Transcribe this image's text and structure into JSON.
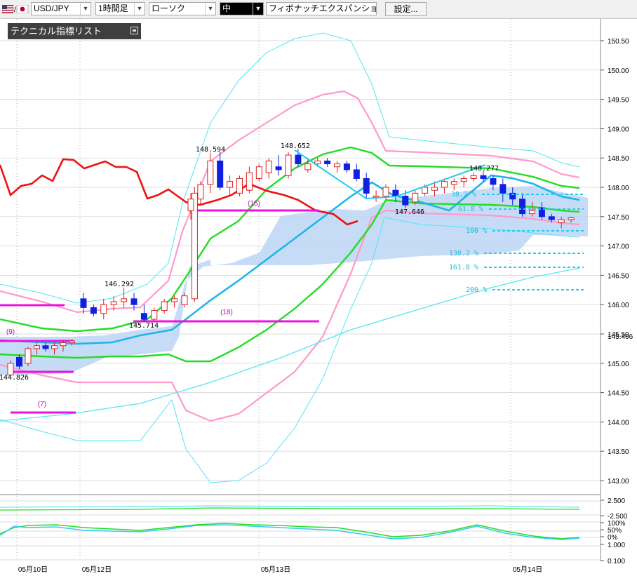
{
  "toolbar": {
    "pair": "USD/JPY",
    "timeframe": "1時間足",
    "chart_type": "ローソク",
    "size": "中",
    "tool": "フィボナッチエクスパンション",
    "settings_button": "設定..."
  },
  "indicator_list": {
    "label": "テクニカル指標リスト"
  },
  "chart_data": {
    "type": "candlestick",
    "price_axis": {
      "min": 142.85,
      "max": 150.55,
      "ticks": [
        "150.50",
        "150.00",
        "149.50",
        "149.00",
        "148.50",
        "148.00",
        "147.50",
        "147.00",
        "146.50",
        "146.00",
        "145.50",
        "145.00",
        "144.50",
        "144.00",
        "143.50",
        "143.00"
      ],
      "edge_label": "145.466"
    },
    "sub_axis": {
      "ticks": [
        "2.500",
        "-2.500",
        "100%",
        "50%",
        "0%",
        "1.000",
        "0.100"
      ]
    },
    "date_labels": [
      "05月10日",
      "05月12日",
      "05月13日",
      "05月14日"
    ],
    "price_labels": [
      "144.826",
      "146.292",
      "145.714",
      "148.594",
      "148.652",
      "147.646",
      "148.277"
    ],
    "line_labels": [
      "(9)",
      "(7)",
      "(18)",
      "(15)"
    ],
    "fib_levels": [
      "38.2 %",
      "61.8 %",
      "100 %",
      "138.2 %",
      "161.8 %",
      "200 %"
    ],
    "candles": [
      [
        144.8,
        145.05,
        144.83,
        145.0
      ],
      [
        145.1,
        145.15,
        144.9,
        144.95
      ],
      [
        145.0,
        145.28,
        144.95,
        145.25
      ],
      [
        145.25,
        145.35,
        145.15,
        145.3
      ],
      [
        145.3,
        145.35,
        145.2,
        145.25
      ],
      [
        145.25,
        145.35,
        145.15,
        145.3
      ],
      [
        145.3,
        145.4,
        145.2,
        145.35
      ],
      [
        145.35,
        145.4,
        145.3,
        145.38
      ],
      [
        146.1,
        146.2,
        145.85,
        145.95
      ],
      [
        145.95,
        146.0,
        145.8,
        145.85
      ],
      [
        145.85,
        146.1,
        145.75,
        146.0
      ],
      [
        146.0,
        146.15,
        145.9,
        146.05
      ],
      [
        146.05,
        146.29,
        145.95,
        146.1
      ],
      [
        146.1,
        146.2,
        145.9,
        146.0
      ],
      [
        145.85,
        146.0,
        145.71,
        145.75
      ],
      [
        145.75,
        145.95,
        145.72,
        145.9
      ],
      [
        145.9,
        146.1,
        145.85,
        146.05
      ],
      [
        146.05,
        146.15,
        145.95,
        146.1
      ],
      [
        146.0,
        146.2,
        145.95,
        146.15
      ],
      [
        146.1,
        148.0,
        146.05,
        147.9
      ],
      [
        147.6,
        147.9,
        147.45,
        147.8
      ],
      [
        147.8,
        148.1,
        147.7,
        148.05
      ],
      [
        148.05,
        148.59,
        147.9,
        148.45
      ],
      [
        148.45,
        148.6,
        147.95,
        148.0
      ],
      [
        148.0,
        148.2,
        147.85,
        148.1
      ],
      [
        147.9,
        148.2,
        147.85,
        148.15
      ],
      [
        147.95,
        148.35,
        147.9,
        148.25
      ],
      [
        148.15,
        148.4,
        148.1,
        148.35
      ],
      [
        148.25,
        148.5,
        148.15,
        148.45
      ],
      [
        148.35,
        148.55,
        148.2,
        148.3
      ],
      [
        148.2,
        148.6,
        148.15,
        148.55
      ],
      [
        148.55,
        148.65,
        148.35,
        148.4
      ],
      [
        148.3,
        148.5,
        148.25,
        148.4
      ],
      [
        148.4,
        148.5,
        148.35,
        148.45
      ],
      [
        148.45,
        148.5,
        148.35,
        148.4
      ],
      [
        148.35,
        148.45,
        148.25,
        148.4
      ],
      [
        148.4,
        148.45,
        148.25,
        148.3
      ],
      [
        148.3,
        148.4,
        148.1,
        148.15
      ],
      [
        148.15,
        148.25,
        147.8,
        147.9
      ],
      [
        147.85,
        147.95,
        147.75,
        147.85
      ],
      [
        147.85,
        148.05,
        147.8,
        148.0
      ],
      [
        147.95,
        148.05,
        147.75,
        147.85
      ],
      [
        147.85,
        147.95,
        147.65,
        147.7
      ],
      [
        147.75,
        147.95,
        147.7,
        147.9
      ],
      [
        147.9,
        148.05,
        147.85,
        148.0
      ],
      [
        147.95,
        148.1,
        147.85,
        148.0
      ],
      [
        148.0,
        148.15,
        147.9,
        148.1
      ],
      [
        148.05,
        148.15,
        147.95,
        148.1
      ],
      [
        148.1,
        148.2,
        148.0,
        148.15
      ],
      [
        148.15,
        148.25,
        148.1,
        148.2
      ],
      [
        148.2,
        148.28,
        148.1,
        148.15
      ],
      [
        148.15,
        148.2,
        147.95,
        148.05
      ],
      [
        148.05,
        148.15,
        147.75,
        147.9
      ],
      [
        147.9,
        148.0,
        147.7,
        147.8
      ],
      [
        147.8,
        147.9,
        147.5,
        147.55
      ],
      [
        147.55,
        147.75,
        147.5,
        147.6
      ],
      [
        147.65,
        147.75,
        147.45,
        147.5
      ],
      [
        147.5,
        147.55,
        147.4,
        147.45
      ],
      [
        147.4,
        147.5,
        147.3,
        147.45
      ],
      [
        147.45,
        147.5,
        147.4,
        147.48
      ]
    ]
  }
}
